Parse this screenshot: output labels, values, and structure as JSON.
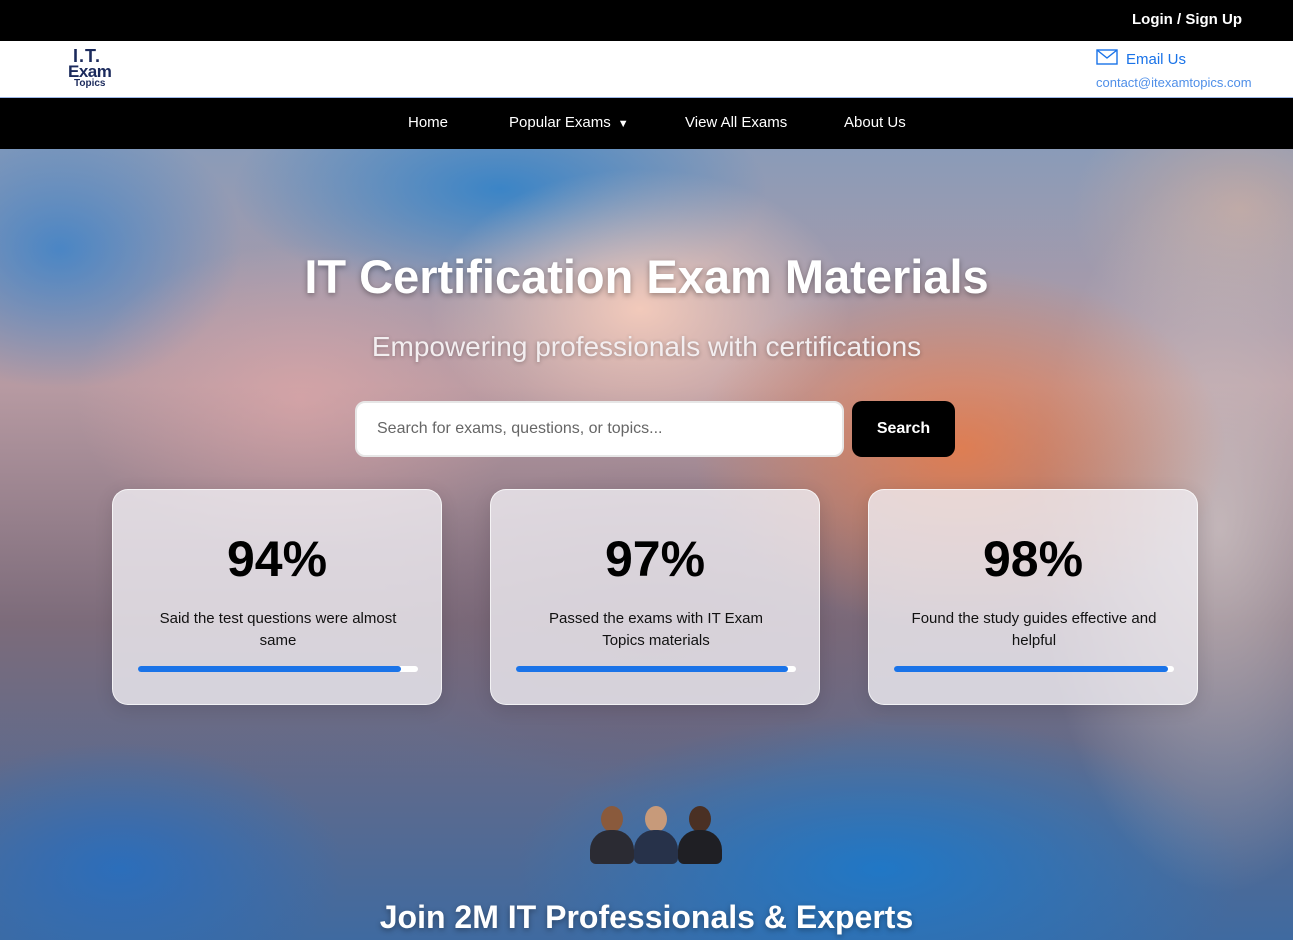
{
  "topbar": {
    "login_label": "Login / Sign Up"
  },
  "header": {
    "logo": {
      "line1": "I.T.",
      "line2": "Exam",
      "line3": "Topics"
    },
    "email_label": "Email Us",
    "email_address": "contact@itexamtopics.com"
  },
  "nav": {
    "items": [
      {
        "label": "Home"
      },
      {
        "label": "Popular Exams",
        "caret": "▼"
      },
      {
        "label": "View All Exams"
      },
      {
        "label": "About Us"
      }
    ]
  },
  "hero": {
    "title": "IT Certification Exam Materials",
    "subtitle": "Empowering professionals with certifications",
    "search_placeholder": "Search for exams, questions, or topics...",
    "search_button": "Search"
  },
  "stats": [
    {
      "value": "94%",
      "label": "Said the test questions were almost same",
      "progress": 0.94
    },
    {
      "value": "97%",
      "label": "Passed the exams with IT Exam Topics materials",
      "progress": 0.97
    },
    {
      "value": "98%",
      "label": "Found the study guides effective and helpful",
      "progress": 0.98
    }
  ],
  "join": {
    "text": "Join 2M IT Professionals & Experts"
  },
  "colors": {
    "accent": "#1a73e8",
    "nav_bg": "#000000"
  }
}
